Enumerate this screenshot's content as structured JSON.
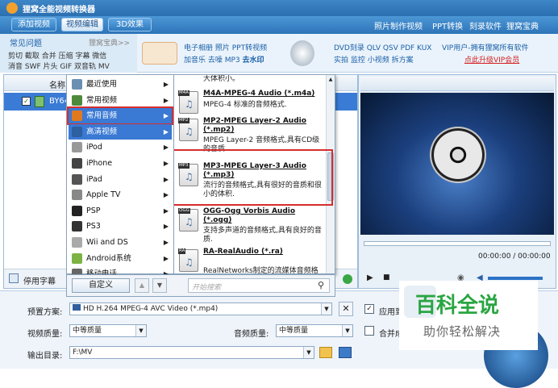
{
  "app": {
    "title": "狸窝全能视频转换器"
  },
  "toolbar": {
    "add_video": "添加视频",
    "edit_video": "视频编辑",
    "effect_3d": "3D效果",
    "photo_video": "照片制作视频",
    "ppt_convert": "PPT转换",
    "burn_software": "刻录软件",
    "liwo_guide": "狸窝宝典"
  },
  "promo": {
    "faq": "常见问题",
    "liwo_guide": "狸窝宝典>>",
    "line1": "剪切 截取 合并 压缩 字幕 微信",
    "line2": "消音 SWF 片头 GIF 双音轨 MV",
    "ppt_line1": "电子相册 照片 PPT转视频",
    "ppt_line2a": "加音乐 去噪 MP3",
    "ppt_line2b": "去水印",
    "dvd_line1": "DVD刻录 QLV QSV PDF KUX",
    "dvd_line2": "实拍 监控 小视频 拆方案",
    "vip_line1": "VIP用户-拥有狸窝所有软件",
    "vip_line2": "点此升级VIP会员"
  },
  "filelist": {
    "col_name": "名称",
    "row_name": "BY64"
  },
  "subtitle": {
    "label": "停用字幕"
  },
  "categories": [
    {
      "label": "最近使用",
      "icon": "clock-icon",
      "color": "#6b8fb3"
    },
    {
      "label": "常用视频",
      "icon": "video-icon",
      "color": "#4f8a3c"
    },
    {
      "label": "常用音频",
      "icon": "music-icon",
      "color": "#e07820"
    },
    {
      "label": "高清视频",
      "icon": "hd-icon",
      "color": "#2e5f9e"
    },
    {
      "label": "iPod",
      "icon": "ipod-icon",
      "color": "#999999"
    },
    {
      "label": "iPhone",
      "icon": "iphone-icon",
      "color": "#444444"
    },
    {
      "label": "iPad",
      "icon": "ipad-icon",
      "color": "#555555"
    },
    {
      "label": "Apple TV",
      "icon": "apple-icon",
      "color": "#888888"
    },
    {
      "label": "PSP",
      "icon": "psp-icon",
      "color": "#222222"
    },
    {
      "label": "PS3",
      "icon": "ps3-icon",
      "color": "#333333"
    },
    {
      "label": "Wii and DS",
      "icon": "wii-icon",
      "color": "#aaaaaa"
    },
    {
      "label": "Android系统",
      "icon": "android-icon",
      "color": "#7cb342"
    },
    {
      "label": "移动电话",
      "icon": "phone-icon",
      "color": "#666666"
    }
  ],
  "formats": [
    {
      "partial": "大体积小。"
    },
    {
      "tag": "M4A",
      "title": "M4A-MPEG-4 Audio (*.m4a)",
      "desc": "MPEG-4 标准的音频格式."
    },
    {
      "tag": "MP2",
      "title": "MP2-MPEG Layer-2 Audio (*.mp2)",
      "desc": "MPEG Layer-2 音频格式,具有CD级的音质"
    },
    {
      "tag": "MP3",
      "title": "MP3-MPEG Layer-3 Audio (*.mp3)",
      "desc": "流行的音频格式,具有很好的音质和很小的体积."
    },
    {
      "tag": "OGG",
      "title": "OGG-Ogg Vorbis Audio (*.ogg)",
      "desc": "支持多声道的音频格式,具有良好的音质."
    },
    {
      "tag": "RA",
      "title": "RA-RealAudio (*.ra)",
      "desc": "RealNetworks制定的流媒体音频格式,能够实时传输的音质"
    }
  ],
  "menu_footer": {
    "custom": "自定义",
    "search_placeholder": "开始搜索"
  },
  "preview": {
    "time": "00:00:00 / 00:00:00"
  },
  "bottom": {
    "preset_label": "预置方案:",
    "preset_value": "HD H.264 MPEG-4 AVC Video (*.mp4)",
    "apply_label": "应用到",
    "video_quality_label": "视频质量:",
    "video_quality_value": "中等质量",
    "audio_quality_label": "音频质量:",
    "audio_quality_value": "中等质量",
    "merge_label": "合并成",
    "output_label": "输出目录:",
    "output_value": "F:\\MV"
  },
  "watermark": {
    "main": "百科全说",
    "sub": "助你轻松解决"
  }
}
